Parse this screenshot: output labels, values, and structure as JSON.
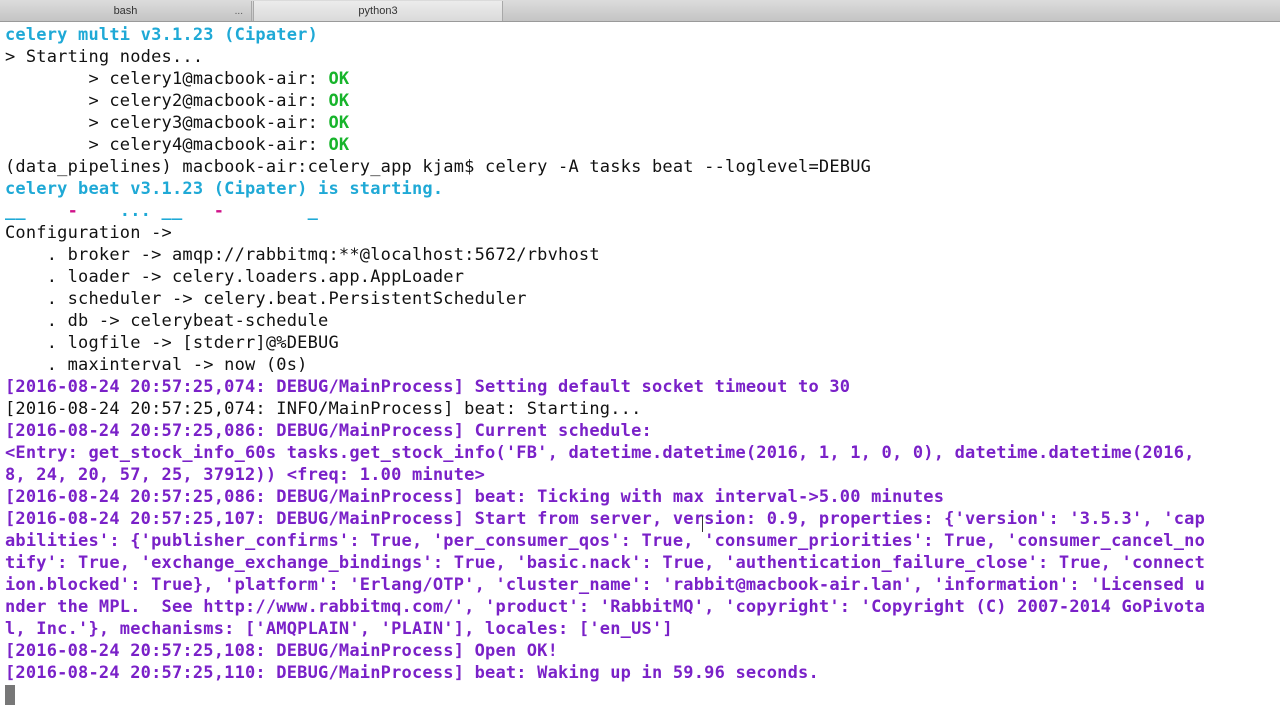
{
  "tabs": [
    {
      "label": "bash"
    },
    {
      "label": "python3"
    }
  ],
  "tab_overflow": "...",
  "colors": {
    "cyan": "#1fa9d6",
    "green": "#17b42b",
    "purple": "#7a21c8",
    "pink": "#d0138a"
  },
  "terminal": {
    "l01": "celery multi v3.1.23 (Cipater)",
    "l02": "> Starting nodes...",
    "l03a": "        > celery1@macbook-air: ",
    "l03b": "OK",
    "l04a": "        > celery2@macbook-air: ",
    "l04b": "OK",
    "l05a": "        > celery3@macbook-air: ",
    "l05b": "OK",
    "l06a": "        > celery4@macbook-air: ",
    "l06b": "OK",
    "l07": "(data_pipelines) macbook-air:celery_app kjam$ celery -A tasks beat --loglevel=DEBUG",
    "l08": "celery beat v3.1.23 (Cipater) is starting.",
    "l09a": "__    ",
    "l09b": "-",
    "l09c": "    ... __   ",
    "l09d": "-",
    "l09e": "        _",
    "l10": "Configuration ->",
    "l11": "    . broker -> amqp://rabbitmq:**@localhost:5672/rbvhost",
    "l12": "    . loader -> celery.loaders.app.AppLoader",
    "l13": "    . scheduler -> celery.beat.PersistentScheduler",
    "l14": "    . db -> celerybeat-schedule",
    "l15": "    . logfile -> [stderr]@%DEBUG",
    "l16": "    . maxinterval -> now (0s)",
    "l17": "[2016-08-24 20:57:25,074: DEBUG/MainProcess] Setting default socket timeout to 30",
    "l18": "[2016-08-24 20:57:25,074: INFO/MainProcess] beat: Starting...",
    "l19": "[2016-08-24 20:57:25,086: DEBUG/MainProcess] Current schedule:",
    "l20": "<Entry: get_stock_info_60s tasks.get_stock_info('FB', datetime.datetime(2016, 1, 1, 0, 0), datetime.datetime(2016,",
    "l21": "8, 24, 20, 57, 25, 37912)) <freq: 1.00 minute>",
    "l22": "[2016-08-24 20:57:25,086: DEBUG/MainProcess] beat: Ticking with max interval->5.00 minutes",
    "l23": "[2016-08-24 20:57:25,107: DEBUG/MainProcess] Start from server, version: 0.9, properties: {'version': '3.5.3', 'cap",
    "l24": "abilities': {'publisher_confirms': True, 'per_consumer_qos': True, 'consumer_priorities': True, 'consumer_cancel_no",
    "l25": "tify': True, 'exchange_exchange_bindings': True, 'basic.nack': True, 'authentication_failure_close': True, 'connect",
    "l26": "ion.blocked': True}, 'platform': 'Erlang/OTP', 'cluster_name': 'rabbit@macbook-air.lan', 'information': 'Licensed u",
    "l27": "nder the MPL.  See http://www.rabbitmq.com/', 'product': 'RabbitMQ', 'copyright': 'Copyright (C) 2007-2014 GoPivota",
    "l28": "l, Inc.'}, mechanisms: ['AMQPLAIN', 'PLAIN'], locales: ['en_US']",
    "l29": "[2016-08-24 20:57:25,108: DEBUG/MainProcess] Open OK!",
    "l30": "[2016-08-24 20:57:25,110: DEBUG/MainProcess] beat: Waking up in 59.96 seconds."
  }
}
